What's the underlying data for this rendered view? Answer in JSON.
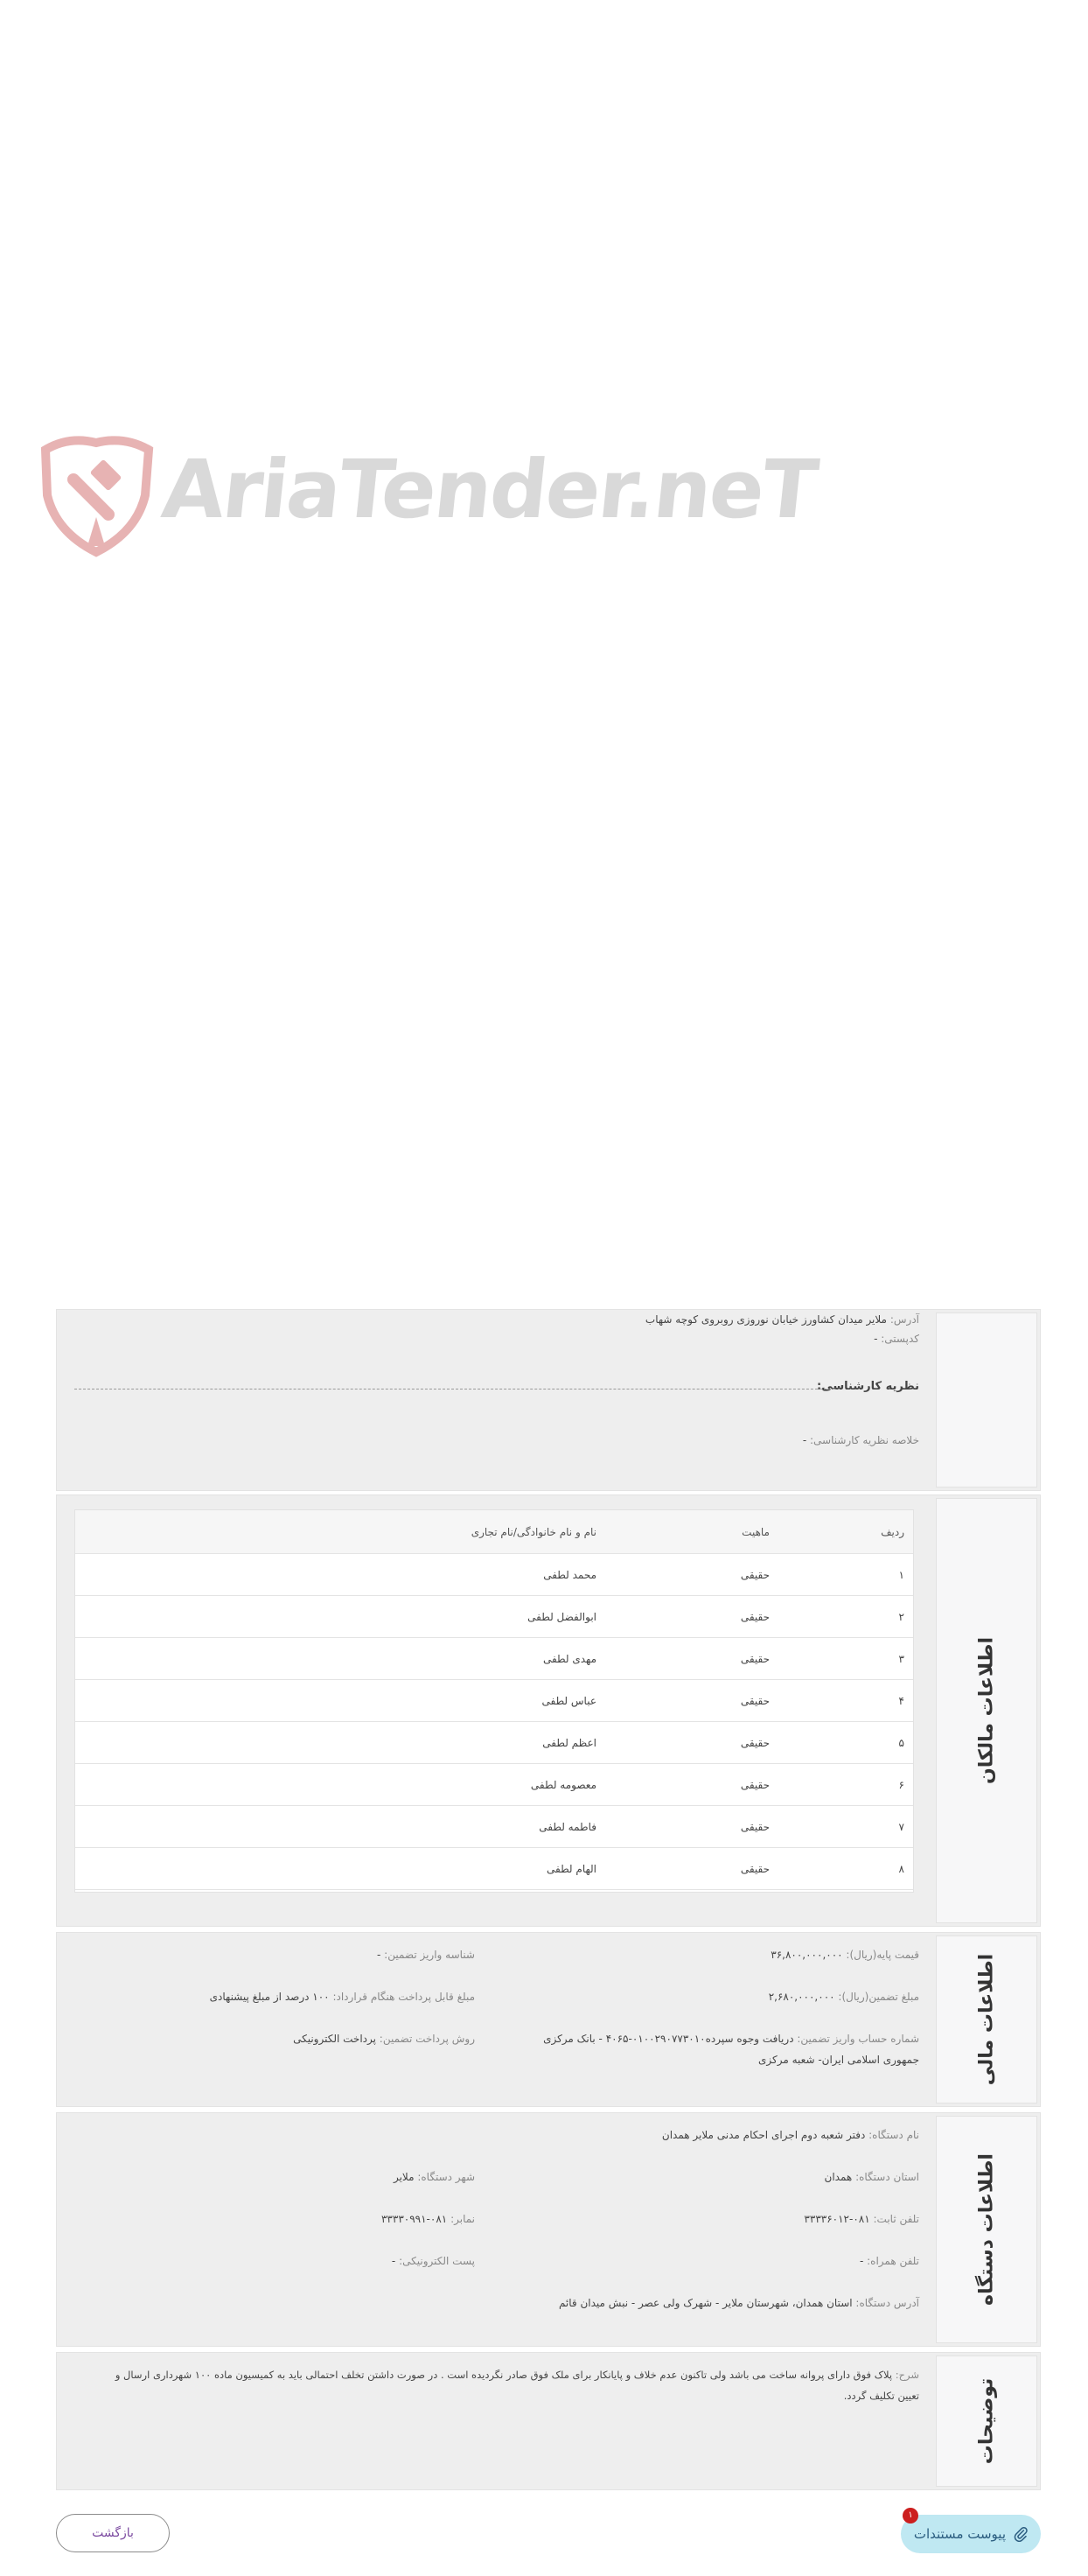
{
  "watermark": {
    "text": "AriaTender.neT"
  },
  "expert": {
    "address_label": "آدرس:",
    "address_value": "ملایر میدان کشاورز خیابان نوروزی روبروی کوچه شهاب",
    "postal_label": "کدپستی:",
    "postal_value": "-",
    "opinion_title": "نظریه کارشناسی:",
    "summary_label": "خلاصه نظریه کارشناسی:",
    "summary_value": "-"
  },
  "owners": {
    "title": "اطلاعات مالکان",
    "columns": [
      "ردیف",
      "ماهیت",
      "نام و نام خانوادگی/نام تجاری"
    ],
    "rows": [
      {
        "idx": "۱",
        "type": "حقیقی",
        "name": "محمد لطفی"
      },
      {
        "idx": "۲",
        "type": "حقیقی",
        "name": "ابوالفضل لطفی"
      },
      {
        "idx": "۳",
        "type": "حقیقی",
        "name": "مهدی لطفی"
      },
      {
        "idx": "۴",
        "type": "حقیقی",
        "name": "عباس لطفی"
      },
      {
        "idx": "۵",
        "type": "حقیقی",
        "name": "اعظم لطفی"
      },
      {
        "idx": "۶",
        "type": "حقیقی",
        "name": "معصومه لطفی"
      },
      {
        "idx": "۷",
        "type": "حقیقی",
        "name": "فاطمه لطفی"
      },
      {
        "idx": "۸",
        "type": "حقیقی",
        "name": "الهام لطفی"
      }
    ]
  },
  "financial": {
    "title": "اطلاعات مالی",
    "price_label": "قیمت پایه(ریال):",
    "price_value": "۳۶,۸۰۰,۰۰۰,۰۰۰",
    "deposit_id_label": "شناسه واریز تضمین:",
    "deposit_id_value": "-",
    "guarantee_label": "مبلغ تضمین(ریال):",
    "guarantee_value": "۲,۶۸۰,۰۰۰,۰۰۰",
    "payable_label": "مبلغ قابل پرداخت هنگام قرارداد:",
    "payable_value": "۱۰۰ درصد از مبلغ پیشنهادی",
    "account_label": "شماره حساب واریز تضمین:",
    "account_value_line1": "دریافت وجوه سپرده۰۱۰۰۲۹۰۷۷۳۰۱۰-۴۰۶۵ - بانک مرکزی",
    "account_value_line2": "جمهوری اسلامی ایران- شعبه مرکزی",
    "method_label": "روش پرداخت تضمین:",
    "method_value": "پرداخت الکترونیکی"
  },
  "device": {
    "title": "اطلاعات دستگاه",
    "name_label": "نام دستگاه:",
    "name_value": "دفتر شعبه دوم اجرای احکام مدنی ملایر همدان",
    "province_label": "استان دستگاه:",
    "province_value": "همدان",
    "city_label": "شهر دستگاه:",
    "city_value": "ملایر",
    "phone_label": "تلفن ثابت:",
    "phone_value": "۰۸۱-۳۳۳۳۶۰۱۲",
    "fax_label": "نمابر:",
    "fax_value": "۰۸۱-۳۳۳۳۰۹۹۱",
    "mobile_label": "تلفن همراه:",
    "mobile_value": "-",
    "email_label": "پست الکترونیکی:",
    "email_value": "-",
    "address_label": "آدرس دستگاه:",
    "address_value": "استان همدان، شهرستان ملایر - شهرک ولی عصر - نبش میدان قائم"
  },
  "description": {
    "title": "توضیحات",
    "label": "شرح:",
    "line1": "پلاک فوق دارای پروانه ساخت می باشد ولی تاکنون عدم خلاف و پایانکار برای ملک فوق صادر نگردیده است . در صورت داشتن تخلف احتمالی باید به کمیسیون ماده ۱۰۰ شهرداری ارسال و",
    "line2": "تعیین تکلیف گردد."
  },
  "actions": {
    "docs_label": "پیوست مستندات",
    "docs_count": "۱",
    "back_label": "بازگشت"
  },
  "colors": {
    "accent_light": "#bfe8f2",
    "badge": "#cc1f1f",
    "back_text": "#7b4aa0",
    "watermark_red": "#e7b3b3",
    "watermark_gray": "#d9d9d9"
  }
}
